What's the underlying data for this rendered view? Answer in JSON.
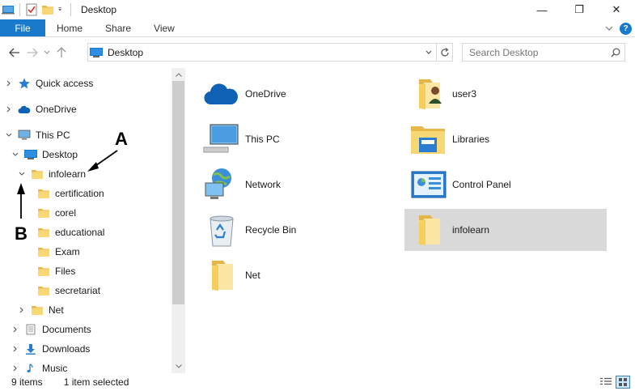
{
  "window": {
    "title": "Desktop",
    "minimize_glyph": "—",
    "maximize_glyph": "❐",
    "close_glyph": "✕"
  },
  "ribbon": {
    "file_label": "File",
    "tabs": [
      {
        "label": "Home"
      },
      {
        "label": "Share"
      },
      {
        "label": "View"
      }
    ],
    "help_glyph": "?"
  },
  "address": {
    "path": "Desktop",
    "search_placeholder": "Search Desktop"
  },
  "nav_tree": [
    {
      "label": "Quick access",
      "icon": "star-icon"
    },
    {
      "label": "OneDrive",
      "icon": "cloud-icon"
    },
    {
      "label": "This PC",
      "icon": "computer-icon"
    },
    {
      "label": "Desktop",
      "icon": "desktop-icon"
    },
    {
      "label": "infolearn",
      "icon": "folder-icon"
    },
    {
      "label": "certification",
      "icon": "folder-icon"
    },
    {
      "label": "corel",
      "icon": "folder-icon"
    },
    {
      "label": "educational",
      "icon": "folder-icon"
    },
    {
      "label": "Exam",
      "icon": "folder-icon"
    },
    {
      "label": "Files",
      "icon": "folder-icon"
    },
    {
      "label": "secretariat",
      "icon": "folder-icon"
    },
    {
      "label": "Net",
      "icon": "folder-icon"
    },
    {
      "label": "Documents",
      "icon": "documents-icon"
    },
    {
      "label": "Downloads",
      "icon": "download-icon"
    },
    {
      "label": "Music",
      "icon": "music-icon"
    }
  ],
  "items": [
    {
      "label": "OneDrive",
      "icon": "cloud-icon"
    },
    {
      "label": "user3",
      "icon": "user-folder-icon"
    },
    {
      "label": "This PC",
      "icon": "computer-icon"
    },
    {
      "label": "Libraries",
      "icon": "libraries-icon"
    },
    {
      "label": "Network",
      "icon": "network-icon"
    },
    {
      "label": "Control Panel",
      "icon": "control-panel-icon"
    },
    {
      "label": "Recycle Bin",
      "icon": "recycle-bin-icon"
    },
    {
      "label": "infolearn",
      "icon": "folder-icon",
      "selected": true
    },
    {
      "label": "Net",
      "icon": "folder-icon"
    }
  ],
  "status": {
    "item_count": "9 items",
    "selection": "1 item selected"
  },
  "annotations": {
    "a": "A",
    "b": "B"
  },
  "colors": {
    "accent": "#1979ca",
    "folder": "#f8d775",
    "selected_bg": "#d9d9d9"
  }
}
